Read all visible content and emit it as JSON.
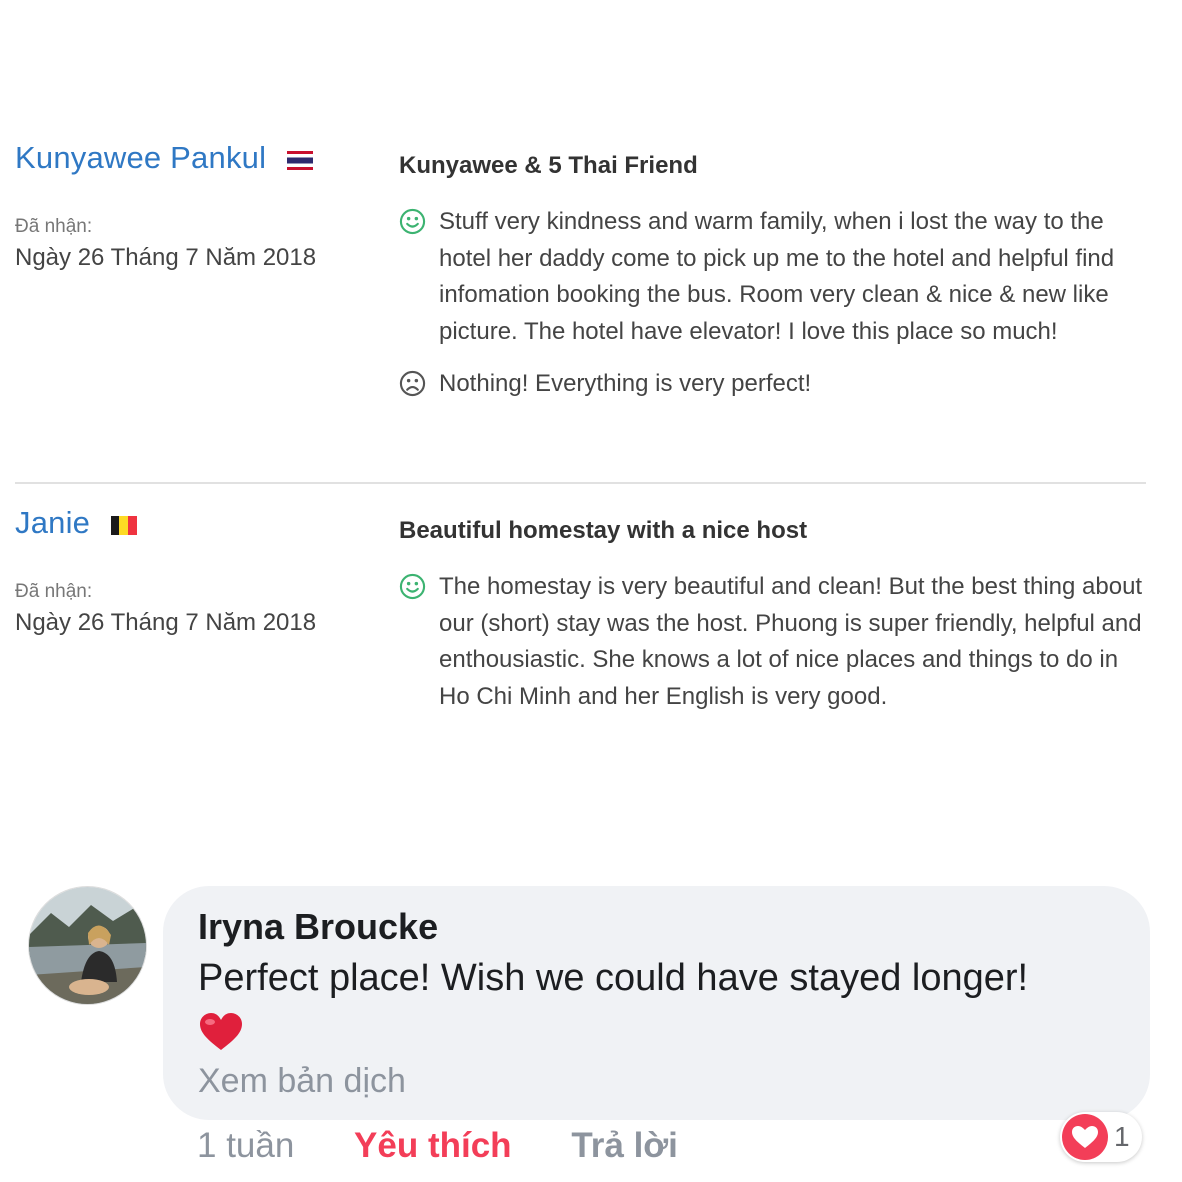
{
  "reviews": [
    {
      "reviewer": "Kunyawee Pankul",
      "flag": "thailand-flag",
      "received_label": "Đã nhận:",
      "date": "Ngày 26 Tháng 7 Năm 2018",
      "title": "Kunyawee & 5 Thai Friend",
      "positive": "Stuff very kindness and warm family, when i lost the way to the hotel her daddy come to pick up me to the hotel and helpful find infomation booking the bus. Room very clean & nice & new like picture. The hotel have elevator! I love this place so much!",
      "negative": "Nothing! Everything is very perfect!"
    },
    {
      "reviewer": "Janie",
      "flag": "belgium-flag",
      "received_label": "Đã nhận:",
      "date": "Ngày 26 Tháng 7 Năm 2018",
      "title": "Beautiful homestay with a nice host",
      "positive": "The homestay is very beautiful and clean! But the best thing about our (short) stay was the host. Phuong is super friendly, helpful and enthousiastic. She knows a lot of nice places and things to do in Ho Chi Minh and her English is very good."
    }
  ],
  "comment": {
    "author": "Iryna Broucke",
    "text": "Perfect place! Wish we could have stayed longer!",
    "emoji": "red-heart-emoji",
    "translate": "Xem bản dịch",
    "time": "1 tuần",
    "like": "Yêu thích",
    "reply": "Trả lời",
    "reaction_icon": "heart-reaction-icon",
    "reaction_count": "1"
  },
  "colors": {
    "reviewer_name": "#2f78c4",
    "positive_icon": "#3cb371",
    "negative_icon": "#555555",
    "like_active": "#f33e58",
    "bubble_bg": "#f0f2f5"
  }
}
